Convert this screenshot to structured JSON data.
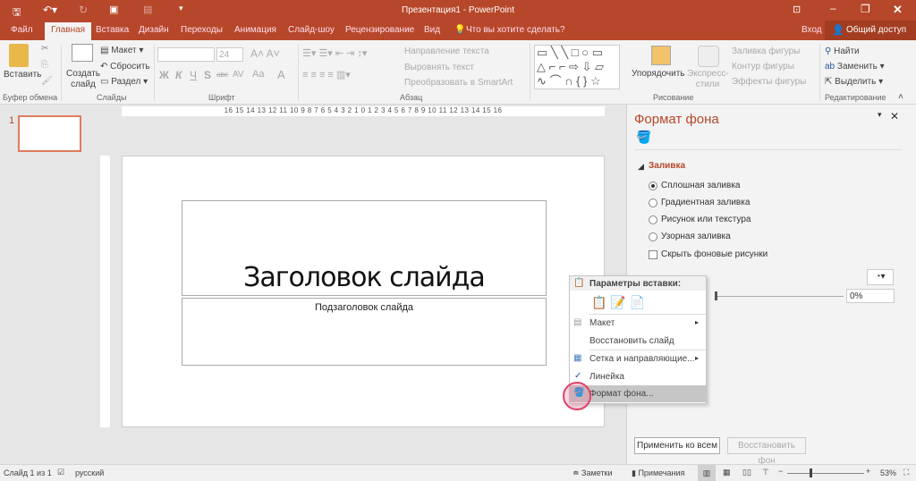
{
  "title_bar": {
    "title": "Презентация1 - PowerPoint",
    "quick_access": [
      "save-icon",
      "undo-icon",
      "redo-icon",
      "start-slideshow-icon",
      "touch-mode-icon",
      "customize-icon"
    ]
  },
  "tabs": [
    "Файл",
    "Главная",
    "Вставка",
    "Дизайн",
    "Переходы",
    "Анимация",
    "Слайд-шоу",
    "Рецензирование",
    "Вид"
  ],
  "active_tab": "Главная",
  "tell_me": "Что вы хотите сделать?",
  "signin": "Вход",
  "share": "Общий доступ",
  "ribbon": {
    "clipboard": {
      "paste": "Вставить",
      "label": "Буфер обмена"
    },
    "slides": {
      "new_slide": "Создать слайд",
      "layout": "Макет",
      "reset": "Сбросить",
      "section": "Раздел",
      "label": "Слайды"
    },
    "font": {
      "font_name": "",
      "font_size": "24",
      "bold": "Ж",
      "italic": "К",
      "underline": "Ч",
      "shadow": "S",
      "strike": "abc",
      "spacing": "AV",
      "case": "Aa",
      "color": "A",
      "label": "Шрифт"
    },
    "paragraph": {
      "text_direction": "Направление текста",
      "align_text": "Выровнять текст",
      "smartart": "Преобразовать в SmartArt",
      "label": "Абзац"
    },
    "drawing": {
      "arrange": "Упорядочить",
      "quick_styles": "Экспресс-стили",
      "shape_fill": "Заливка фигуры",
      "shape_outline": "Контур фигуры",
      "shape_effects": "Эффекты фигуры",
      "label": "Рисование"
    },
    "editing": {
      "find": "Найти",
      "replace": "Заменить",
      "select": "Выделить",
      "label": "Редактирование"
    }
  },
  "ruler": "16 15 14 13 12 11 10 9 8 7 6 5 4 3 2 1 0 1 2 3 4 5 6 7 8 9 10 11 12 13 14 15 16",
  "thumbnail_number": "1",
  "slide": {
    "title": "Заголовок слайда",
    "subtitle": "Подзаголовок слайда"
  },
  "context_menu": {
    "paste_options": "Параметры вставки:",
    "items": [
      "Макет",
      "Восстановить слайд",
      "Сетка и направляющие...",
      "Линейка",
      "Формат фона..."
    ]
  },
  "panel": {
    "title": "Формат фона",
    "section": "Заливка",
    "options": [
      "Сплошная заливка",
      "Градиентная заливка",
      "Рисунок или текстура",
      "Узорная заливка"
    ],
    "selected": "Сплошная заливка",
    "hide_bg": "Скрыть фоновые рисунки",
    "transparency": "0%",
    "apply_all": "Применить ко всем",
    "reset_bg": "Восстановить фон"
  },
  "status": {
    "slide": "Слайд 1 из 1",
    "lang": "русский",
    "notes": "Заметки",
    "comments": "Примечания",
    "zoom": "53%"
  },
  "colors": {
    "accent": "#b7472a"
  }
}
